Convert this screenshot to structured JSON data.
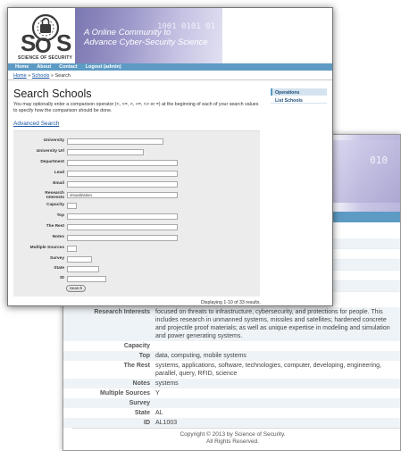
{
  "site": {
    "brand": "SCIENCE OF SECURITY",
    "tagline_1": "A Online Community to",
    "tagline_2": "Advance Cyber-Security Science"
  },
  "nav": [
    "Home",
    "About",
    "Contact",
    "Logout (admin)"
  ],
  "breadcrumb": {
    "home": "Home",
    "sep1": " » ",
    "schools": "Schools",
    "sep2": " » ",
    "current": "Search"
  },
  "page": {
    "title": "Search Schools",
    "intro": "You may optionally enter a comparison operator (<, <=, >, >=, <> or =) at the beginning of each of your search values to specify how the comparison should be done.",
    "advanced_link": "Advanced Search"
  },
  "operations": {
    "heading": "Operations",
    "items": [
      "List Schools"
    ]
  },
  "form": {
    "fields": [
      {
        "label": "University",
        "value": ""
      },
      {
        "label": "University Url",
        "value": ""
      },
      {
        "label": "Department",
        "value": ""
      },
      {
        "label": "Lead",
        "value": ""
      },
      {
        "label": "Email",
        "value": ""
      },
      {
        "label": "Research Interests",
        "value": "visualization"
      },
      {
        "label": "Capacity",
        "value": ""
      },
      {
        "label": "Top",
        "value": ""
      },
      {
        "label": "The Rest",
        "value": ""
      },
      {
        "label": "Notes",
        "value": ""
      },
      {
        "label": "Multiple Sources",
        "value": ""
      },
      {
        "label": "Survey",
        "value": ""
      },
      {
        "label": "State",
        "value": ""
      },
      {
        "label": "ID",
        "value": ""
      }
    ],
    "search_button": "Search"
  },
  "results_summary": "Displaying 1-10 of 33 results.",
  "detail": {
    "rows": [
      {
        "label": "Research Interests",
        "value": "focused on threats to infrastructure, cybersecurity, and protections for people. This includes research in unmanned systems, missiles and satellites; hardened concrete and projectile proof materials; as well as unique expertise in modeling and simulation and power generating systems."
      },
      {
        "label": "Capacity",
        "value": ""
      },
      {
        "label": "Top",
        "value": "data, computing, mobile systems"
      },
      {
        "label": "The Rest",
        "value": "systems, applications, software, technologies, computer, developing, engineering, parallel, query, RFID, science"
      },
      {
        "label": "Notes",
        "value": "systems"
      },
      {
        "label": "Multiple Sources",
        "value": "Y"
      },
      {
        "label": "Survey",
        "value": ""
      },
      {
        "label": "State",
        "value": "AL"
      },
      {
        "label": "ID",
        "value": "AL1003"
      }
    ]
  },
  "footer": {
    "line1": "Copyright © 2013 by Science of Security.",
    "line2": "All Rights Reserved."
  },
  "colors": {
    "nav_bar": "#5d9bc4",
    "link": "#1a55a6",
    "banner": "#9b97c9"
  },
  "icons": {
    "logo": "padlock-logo-icon"
  }
}
